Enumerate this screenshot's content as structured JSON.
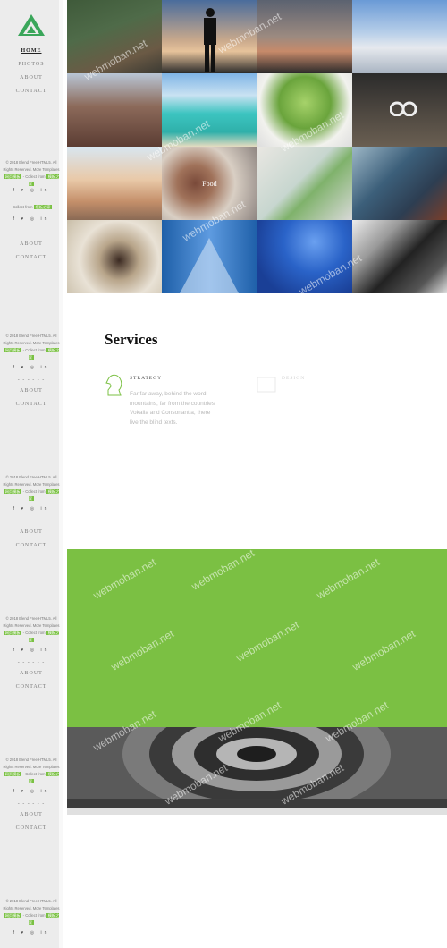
{
  "menu": {
    "home": "HOME",
    "photos": "PHOTOS",
    "about": "ABOUT",
    "contact": "CONTACT"
  },
  "footer": {
    "copyright": "© 2018 Blend Free HTML5. All Rights Reserved. More Templates",
    "collect": "- Collect from",
    "tag1": "网页模板",
    "tag2": "模板之家"
  },
  "social": {
    "icons": [
      "facebook-icon",
      "twitter-icon",
      "instagram-icon",
      "linkedin-icon"
    ],
    "glyphs": "f ♥ ◎ in"
  },
  "grid_label": "Food",
  "services": {
    "title": "Services",
    "items": [
      {
        "title": "STRATEGY",
        "text": "Far far away, behind the word mountains, far from the countries Vokalia and Consonantia, there live the blind texts."
      },
      {
        "title": "DESIGN",
        "text": ""
      }
    ]
  },
  "watermark": "webmoban.net",
  "colors": {
    "accent": "#7bc043",
    "sidebar": "#ececec"
  }
}
